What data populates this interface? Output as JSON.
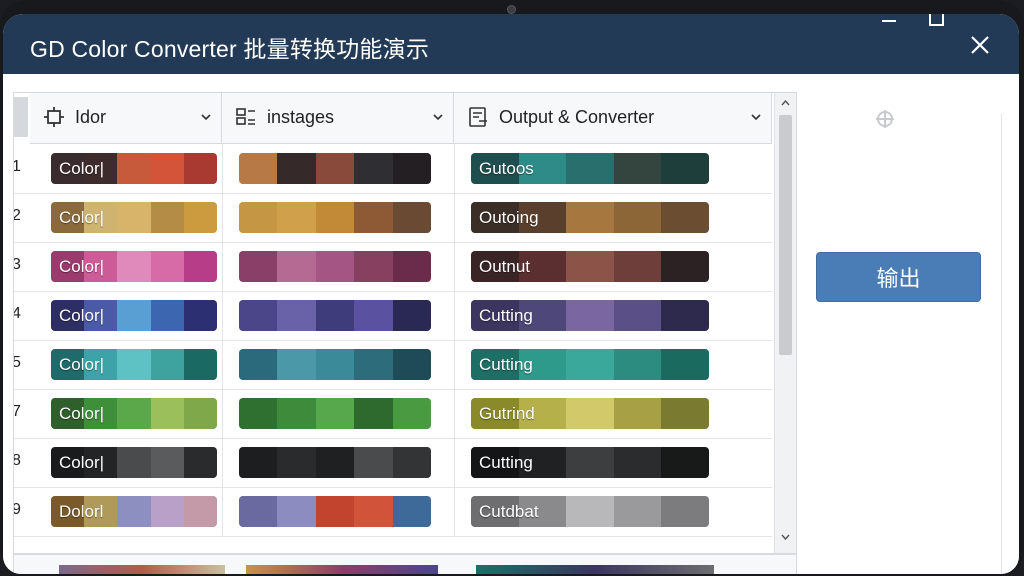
{
  "window": {
    "title": "GD Color Converter 批量转换功能演示",
    "close_icon": "close-icon",
    "maximize_icon": "maximize-icon",
    "minimize_icon": "minimize-icon"
  },
  "columns": [
    {
      "label": "Idor",
      "icon": "crop-icon"
    },
    {
      "label": "instages",
      "icon": "layout-icon"
    },
    {
      "label": "Output & Converter",
      "icon": "document-icon"
    }
  ],
  "rows": [
    {
      "num": "1",
      "col1_text": "Color|",
      "col3_text": "Gutoos",
      "col1_colors": [
        "#3a2b2e",
        "#3e2c2c",
        "#c65a3a",
        "#d4543a",
        "#a83a32"
      ],
      "col2_colors": [
        "#b77945",
        "#352a29",
        "#8a4a3b",
        "#2f2f33",
        "#231f22"
      ],
      "col3_colors": [
        "#1e4f4e",
        "#2f8b88",
        "#286f6d",
        "#34443f",
        "#1d3e3b"
      ]
    },
    {
      "num": "2",
      "col1_text": "Color|",
      "col3_text": "Outoing",
      "col1_colors": [
        "#8a6a3b",
        "#cfb471",
        "#d8b46b",
        "#b58c45",
        "#cc9a3f"
      ],
      "col2_colors": [
        "#c59644",
        "#d1a04b",
        "#c28a36",
        "#8e5a35",
        "#6a4a33"
      ],
      "col3_colors": [
        "#3b2e26",
        "#5a402c",
        "#a6783f",
        "#8d6637",
        "#6b4d31"
      ]
    },
    {
      "num": "3",
      "col1_text": "Color|",
      "col3_text": "Outnut",
      "col1_colors": [
        "#9b3a6c",
        "#cc5b98",
        "#e08abb",
        "#d66ba8",
        "#b83d88"
      ],
      "col2_colors": [
        "#8a3f69",
        "#b46a92",
        "#a45584",
        "#87405f",
        "#6b2c4b"
      ],
      "col3_colors": [
        "#3a2426",
        "#5b2f2f",
        "#8c5449",
        "#6d3e3a",
        "#2c2223"
      ]
    },
    {
      "num": "4",
      "col1_text": "Color|",
      "col3_text": "Cutting",
      "col1_colors": [
        "#2d2e63",
        "#4a5aa6",
        "#5a9fd4",
        "#3d66b0",
        "#2c2f72"
      ],
      "col2_colors": [
        "#4b468a",
        "#6a62a8",
        "#3f3c7c",
        "#5a52a0",
        "#2a2955"
      ],
      "col3_colors": [
        "#3b3560",
        "#4d477a",
        "#7a66a0",
        "#5a4f86",
        "#2e2a4d"
      ]
    },
    {
      "num": "5",
      "col1_text": "Color|",
      "col3_text": "Cutting",
      "col1_colors": [
        "#1f6b6c",
        "#3da3a8",
        "#5ec2c4",
        "#3ea39e",
        "#1a6a63"
      ],
      "col2_colors": [
        "#2b6a7c",
        "#4a98a8",
        "#3b8a9a",
        "#2d6c7a",
        "#1f4a58"
      ],
      "col3_colors": [
        "#1d6f66",
        "#2d9a8c",
        "#3aa99b",
        "#2c8c80",
        "#1b6a60"
      ]
    },
    {
      "num": "7",
      "col1_text": "Color|",
      "col3_text": "Gutrind",
      "col1_colors": [
        "#2f5f2a",
        "#3f8f3a",
        "#5aa84a",
        "#9bbf5a",
        "#7ea84a"
      ],
      "col2_colors": [
        "#2f6f2f",
        "#3e8b3b",
        "#57a84c",
        "#2e6a2d",
        "#4a9a42"
      ],
      "col3_colors": [
        "#8a8a2a",
        "#b5b04a",
        "#d2c96a",
        "#a8a044",
        "#7a7a30"
      ]
    },
    {
      "num": "8",
      "col1_text": "Color|",
      "col3_text": "Cutting",
      "col1_colors": [
        "#1a1b1d",
        "#232426",
        "#4a4b4d",
        "#5a5b5d",
        "#2a2b2d"
      ],
      "col2_colors": [
        "#1d1e20",
        "#2a2b2d",
        "#1f2022",
        "#4a4b4d",
        "#333436"
      ],
      "col3_colors": [
        "#141516",
        "#202123",
        "#3d3e40",
        "#2b2c2e",
        "#181919"
      ]
    },
    {
      "num": "9",
      "col1_text": "Dolorl",
      "col3_text": "Cutdbat",
      "col1_colors": [
        "#7a5a2a",
        "#b09a5a",
        "#8c8fc0",
        "#b8a0c8",
        "#c49aa8"
      ],
      "col2_colors": [
        "#6a6aa0",
        "#8c8cc0",
        "#c2442e",
        "#d0533a",
        "#3e6a9a"
      ],
      "col3_colors": [
        "#6e6e70",
        "#8a8a8c",
        "#b8b8bb",
        "#9a9a9c",
        "#7c7c7e"
      ]
    }
  ],
  "export_button": {
    "label": "输出"
  },
  "side_icon": "snowflake-icon"
}
